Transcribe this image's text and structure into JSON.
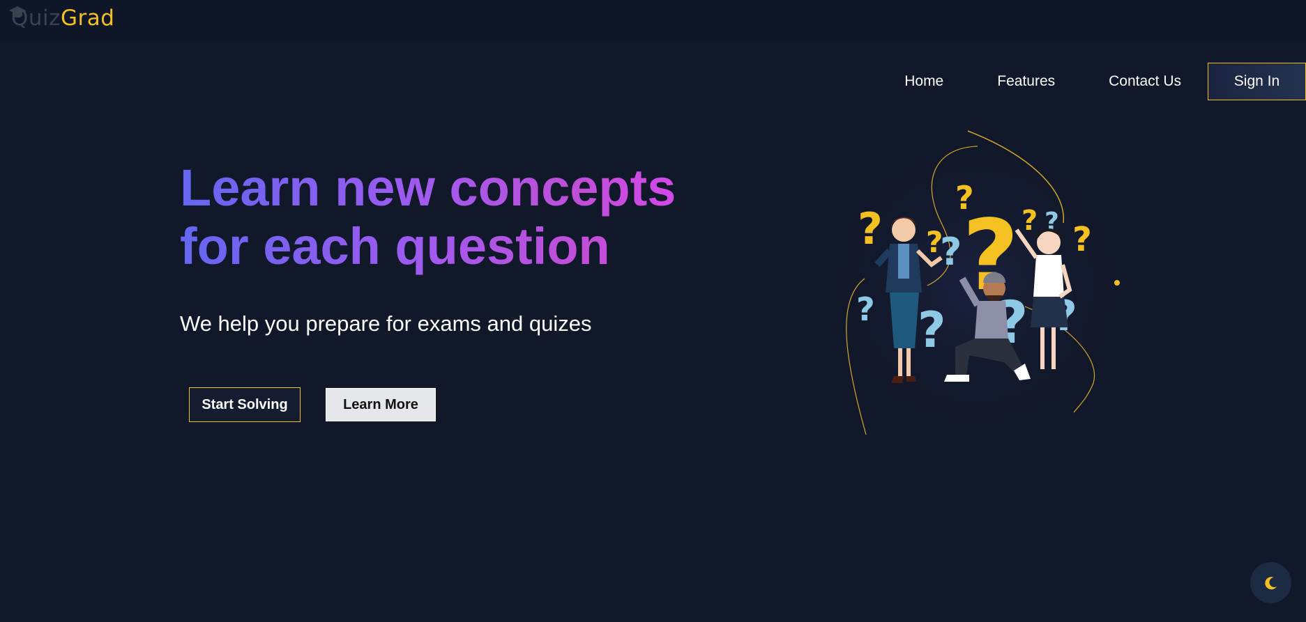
{
  "logo": {
    "part1": "Quiz",
    "part2": "Grad",
    "icon": "graduation-cap-icon"
  },
  "nav": {
    "items": [
      {
        "label": "Home"
      },
      {
        "label": "Features"
      },
      {
        "label": "Contact Us"
      }
    ],
    "signin_label": "Sign In"
  },
  "hero": {
    "title_line1": "Learn new concepts",
    "title_line2": "for each question",
    "subtitle": "We help you prepare for exams and quizes",
    "start_button": "Start Solving",
    "learn_button": "Learn More",
    "illustration": "people-with-question-marks-illustration"
  },
  "theme_toggle": {
    "icon": "moon-icon"
  },
  "colors": {
    "background": "#111829",
    "accent": "#f5c022",
    "gradient_start": "#6366f1",
    "gradient_end": "#d946ef",
    "question_blue": "#8ecae6",
    "question_yellow": "#f5c022"
  }
}
